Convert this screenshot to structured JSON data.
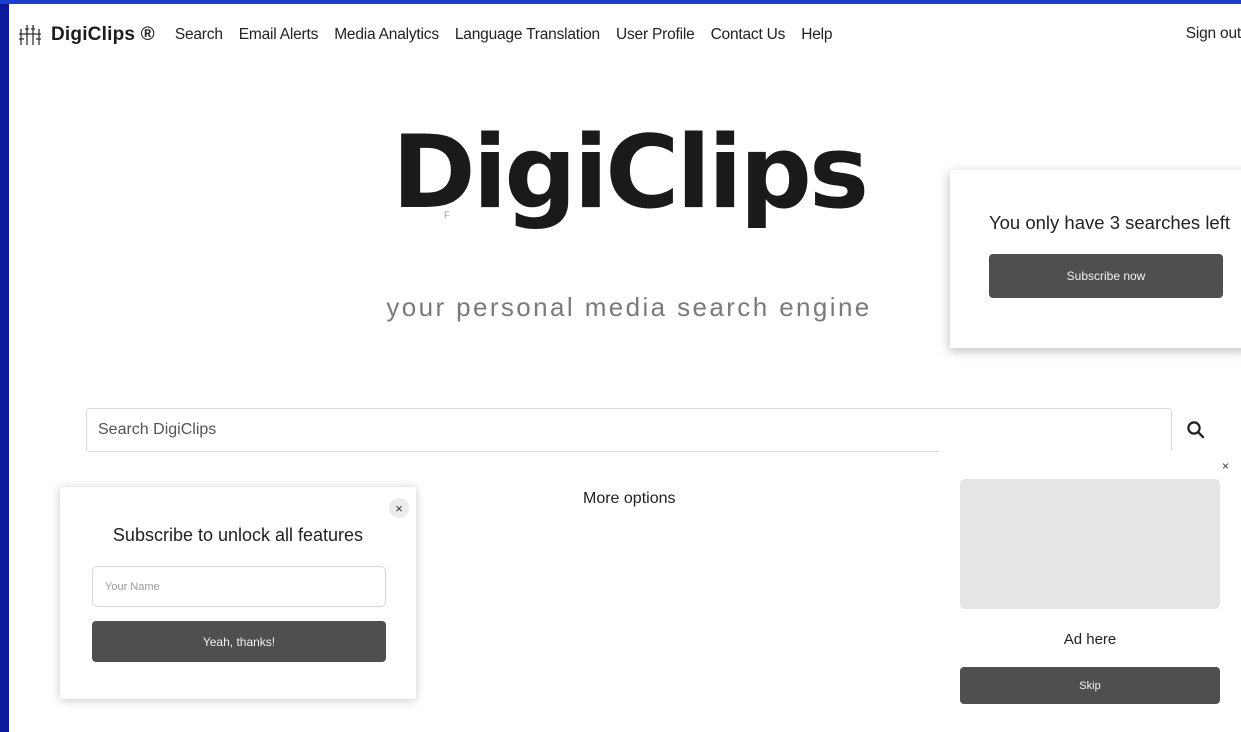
{
  "nav": {
    "brand": "DigiClips ®",
    "links": [
      "Search",
      "Email Alerts",
      "Media Analytics",
      "Language Translation",
      "User Profile",
      "Contact Us",
      "Help"
    ],
    "sign_out": "Sign out"
  },
  "hero": {
    "title": "DigiClips",
    "ghost_text": "F",
    "tagline": "your personal media search engine"
  },
  "limit_card": {
    "message": "You only have 3 searches left",
    "button": "Subscribe now"
  },
  "search": {
    "placeholder": "Search DigiClips",
    "value": ""
  },
  "more_options": "More options",
  "subscribe_popup": {
    "close": "×",
    "heading": "Subscribe to unlock all features",
    "name_placeholder": "Your Name",
    "button": "Yeah, thanks!"
  },
  "ad": {
    "close": "×",
    "label": "Ad here",
    "button": "Skip"
  },
  "colors": {
    "frame": "#0a1a9a",
    "button": "#4f4f4f",
    "ad_placeholder": "#e5e5e5"
  }
}
